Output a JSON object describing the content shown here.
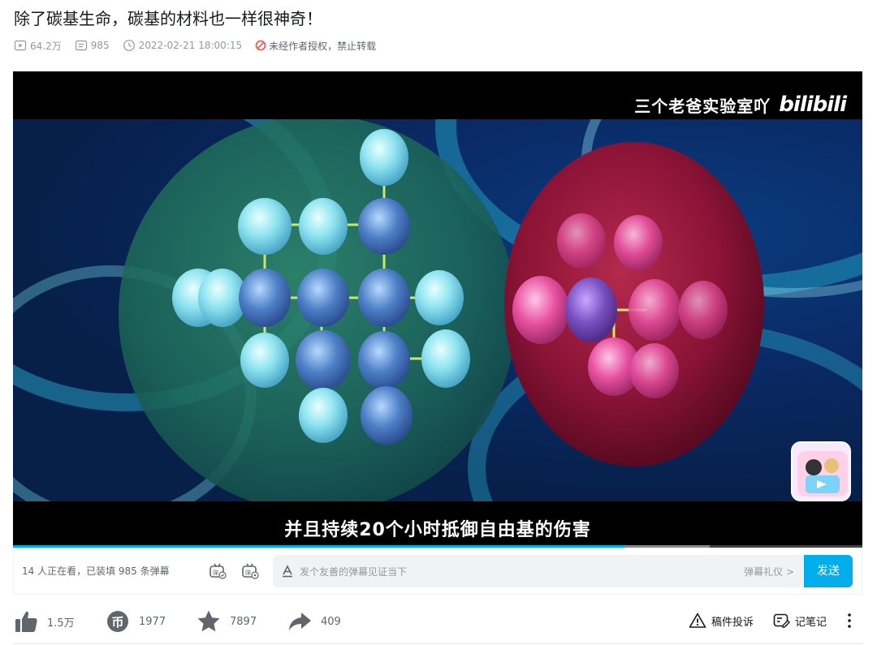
{
  "video": {
    "title": "除了碳基生命，碳基的材料也一样很神奇！",
    "views": "64.2万",
    "danmaku_count": "985",
    "publish_time": "2022-02-21 18:00:15",
    "copyright_notice": "未经作者授权，禁止转载"
  },
  "player": {
    "watermark_channel": "三个老爸实验室吖",
    "watermark_logo": "bilibili",
    "subtitle": "并且持续20个小时抵御自由基的伤害",
    "progress_fraction": 0.72,
    "buffer_fraction": 0.1
  },
  "danmaku_bar": {
    "viewers_text": "14 人正在看，已装填 985 条弹幕",
    "input_placeholder": "发个友善的弹幕见证当下",
    "etiquette_link": "弹幕礼仪 >",
    "send_label": "发送"
  },
  "actions": {
    "like_count": "1.5万",
    "coin_count": "1977",
    "favorite_count": "7897",
    "share_count": "409",
    "report_label": "稿件投诉",
    "notes_label": "记笔记"
  },
  "colors": {
    "accent": "#00aeec",
    "icon_gray": "#61666d",
    "warning_red": "#f25d59"
  }
}
